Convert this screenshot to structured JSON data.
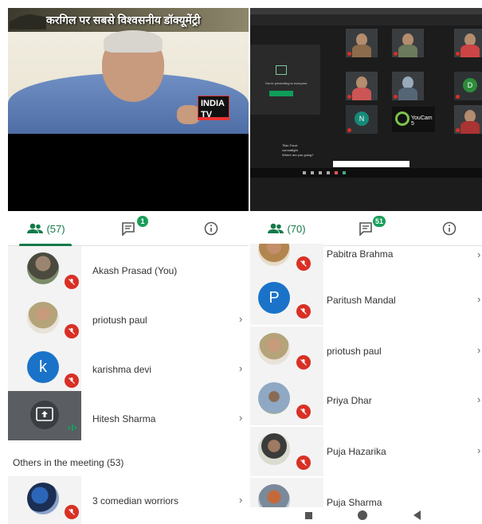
{
  "left_video": {
    "headline": "करगिल पर सबसे विश्वसनीय डॉक्यूमेंट्री",
    "channel_logo": "INDIA TV"
  },
  "left_panel": {
    "people_tab_label": "(57)",
    "chat_badge": "1",
    "participants": [
      {
        "name": "Akash Prasad (You)",
        "avatar": "photo",
        "muted": true,
        "chevron": false
      },
      {
        "name": "priotush paul",
        "avatar": "photo",
        "muted": true,
        "chevron": true
      },
      {
        "name": "karishma devi",
        "avatar_letter": "k",
        "avatar": "letter",
        "muted": true,
        "chevron": true
      },
      {
        "name": "Hitesh Sharma",
        "avatar": "presenting",
        "muted": false,
        "chevron": true
      }
    ],
    "section_label": "Others in the meeting (53)",
    "others": [
      {
        "name": "3 comedian worriors",
        "avatar": "photo",
        "muted": true,
        "chevron": true
      }
    ]
  },
  "right_video": {
    "presenting_text": "You're presenting to everyone",
    "stop_button": "Stop presenting",
    "tile_letter_d": "D",
    "tile_letter_n": "N",
    "youcam_label": "YouCam 5",
    "chat_line_1": "Tilan Fouzi",
    "chat_line_2": "coronafight",
    "chat_line_3": "Where are you going?"
  },
  "right_panel": {
    "people_tab_label": "(70)",
    "chat_badge": "51",
    "participants": [
      {
        "name": "Pabitra Brahma",
        "avatar": "photo",
        "muted": true
      },
      {
        "name": "Paritush Mandal",
        "avatar_letter": "P",
        "avatar": "letter",
        "muted": true
      },
      {
        "name": "priotush paul",
        "avatar": "photo",
        "muted": true
      },
      {
        "name": "Priya Dhar",
        "avatar": "photo",
        "muted": true
      },
      {
        "name": "Puja Hazarika",
        "avatar": "photo",
        "muted": true
      },
      {
        "name": "Puja Sharma",
        "avatar": "photo",
        "muted": true
      }
    ]
  },
  "colors": {
    "accent_green": "#137a4a",
    "mute_red": "#d93025",
    "letter_avatar_blue": "#1a73c9",
    "badge_green": "#1a9e5a"
  },
  "icons": {
    "people": "people-icon",
    "chat": "chat-icon",
    "info": "info-icon",
    "muted_mic": "mic-off-icon",
    "chevron": "chevron-right-icon",
    "present": "present-screen-icon"
  }
}
